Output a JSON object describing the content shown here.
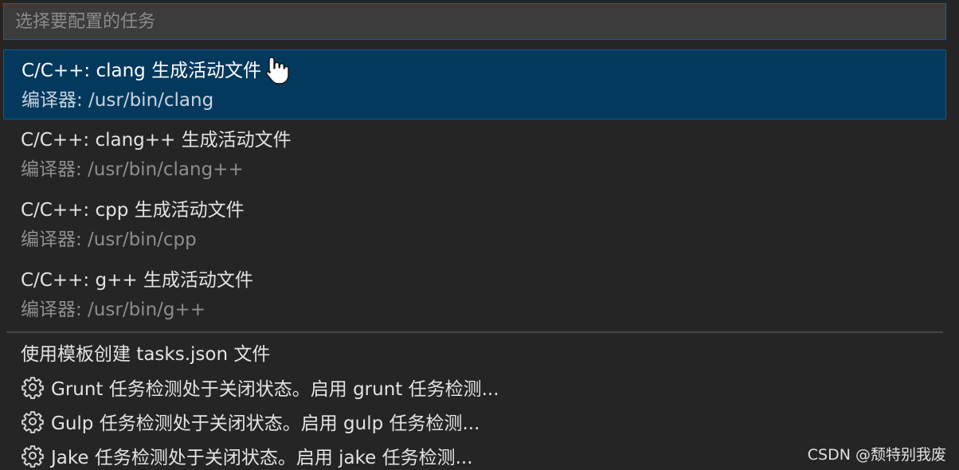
{
  "search": {
    "placeholder": "选择要配置的任务"
  },
  "items": [
    {
      "label": "C/C++: clang 生成活动文件",
      "desc": "编译器: /usr/bin/clang",
      "active": true
    },
    {
      "label": "C/C++: clang++ 生成活动文件",
      "desc": "编译器: /usr/bin/clang++",
      "active": false
    },
    {
      "label": "C/C++: cpp 生成活动文件",
      "desc": "编译器: /usr/bin/cpp",
      "active": false
    },
    {
      "label": "C/C++: g++ 生成活动文件",
      "desc": "编译器: /usr/bin/g++",
      "active": false
    }
  ],
  "template_option": "使用模板创建 tasks.json 文件",
  "detection": [
    {
      "icon": "gear-icon",
      "text": "Grunt 任务检测处于关闭状态。启用 grunt 任务检测..."
    },
    {
      "icon": "gear-icon",
      "text": "Gulp 任务检测处于关闭状态。启用 gulp 任务检测..."
    },
    {
      "icon": "gear-icon",
      "text": "Jake 任务检测处于关闭状态。启用 jake 任务检测..."
    }
  ],
  "watermark": "CSDN @颓特别我废",
  "colors": {
    "background": "#252526",
    "selection": "#04395e",
    "focus_border": "#0e639c"
  }
}
